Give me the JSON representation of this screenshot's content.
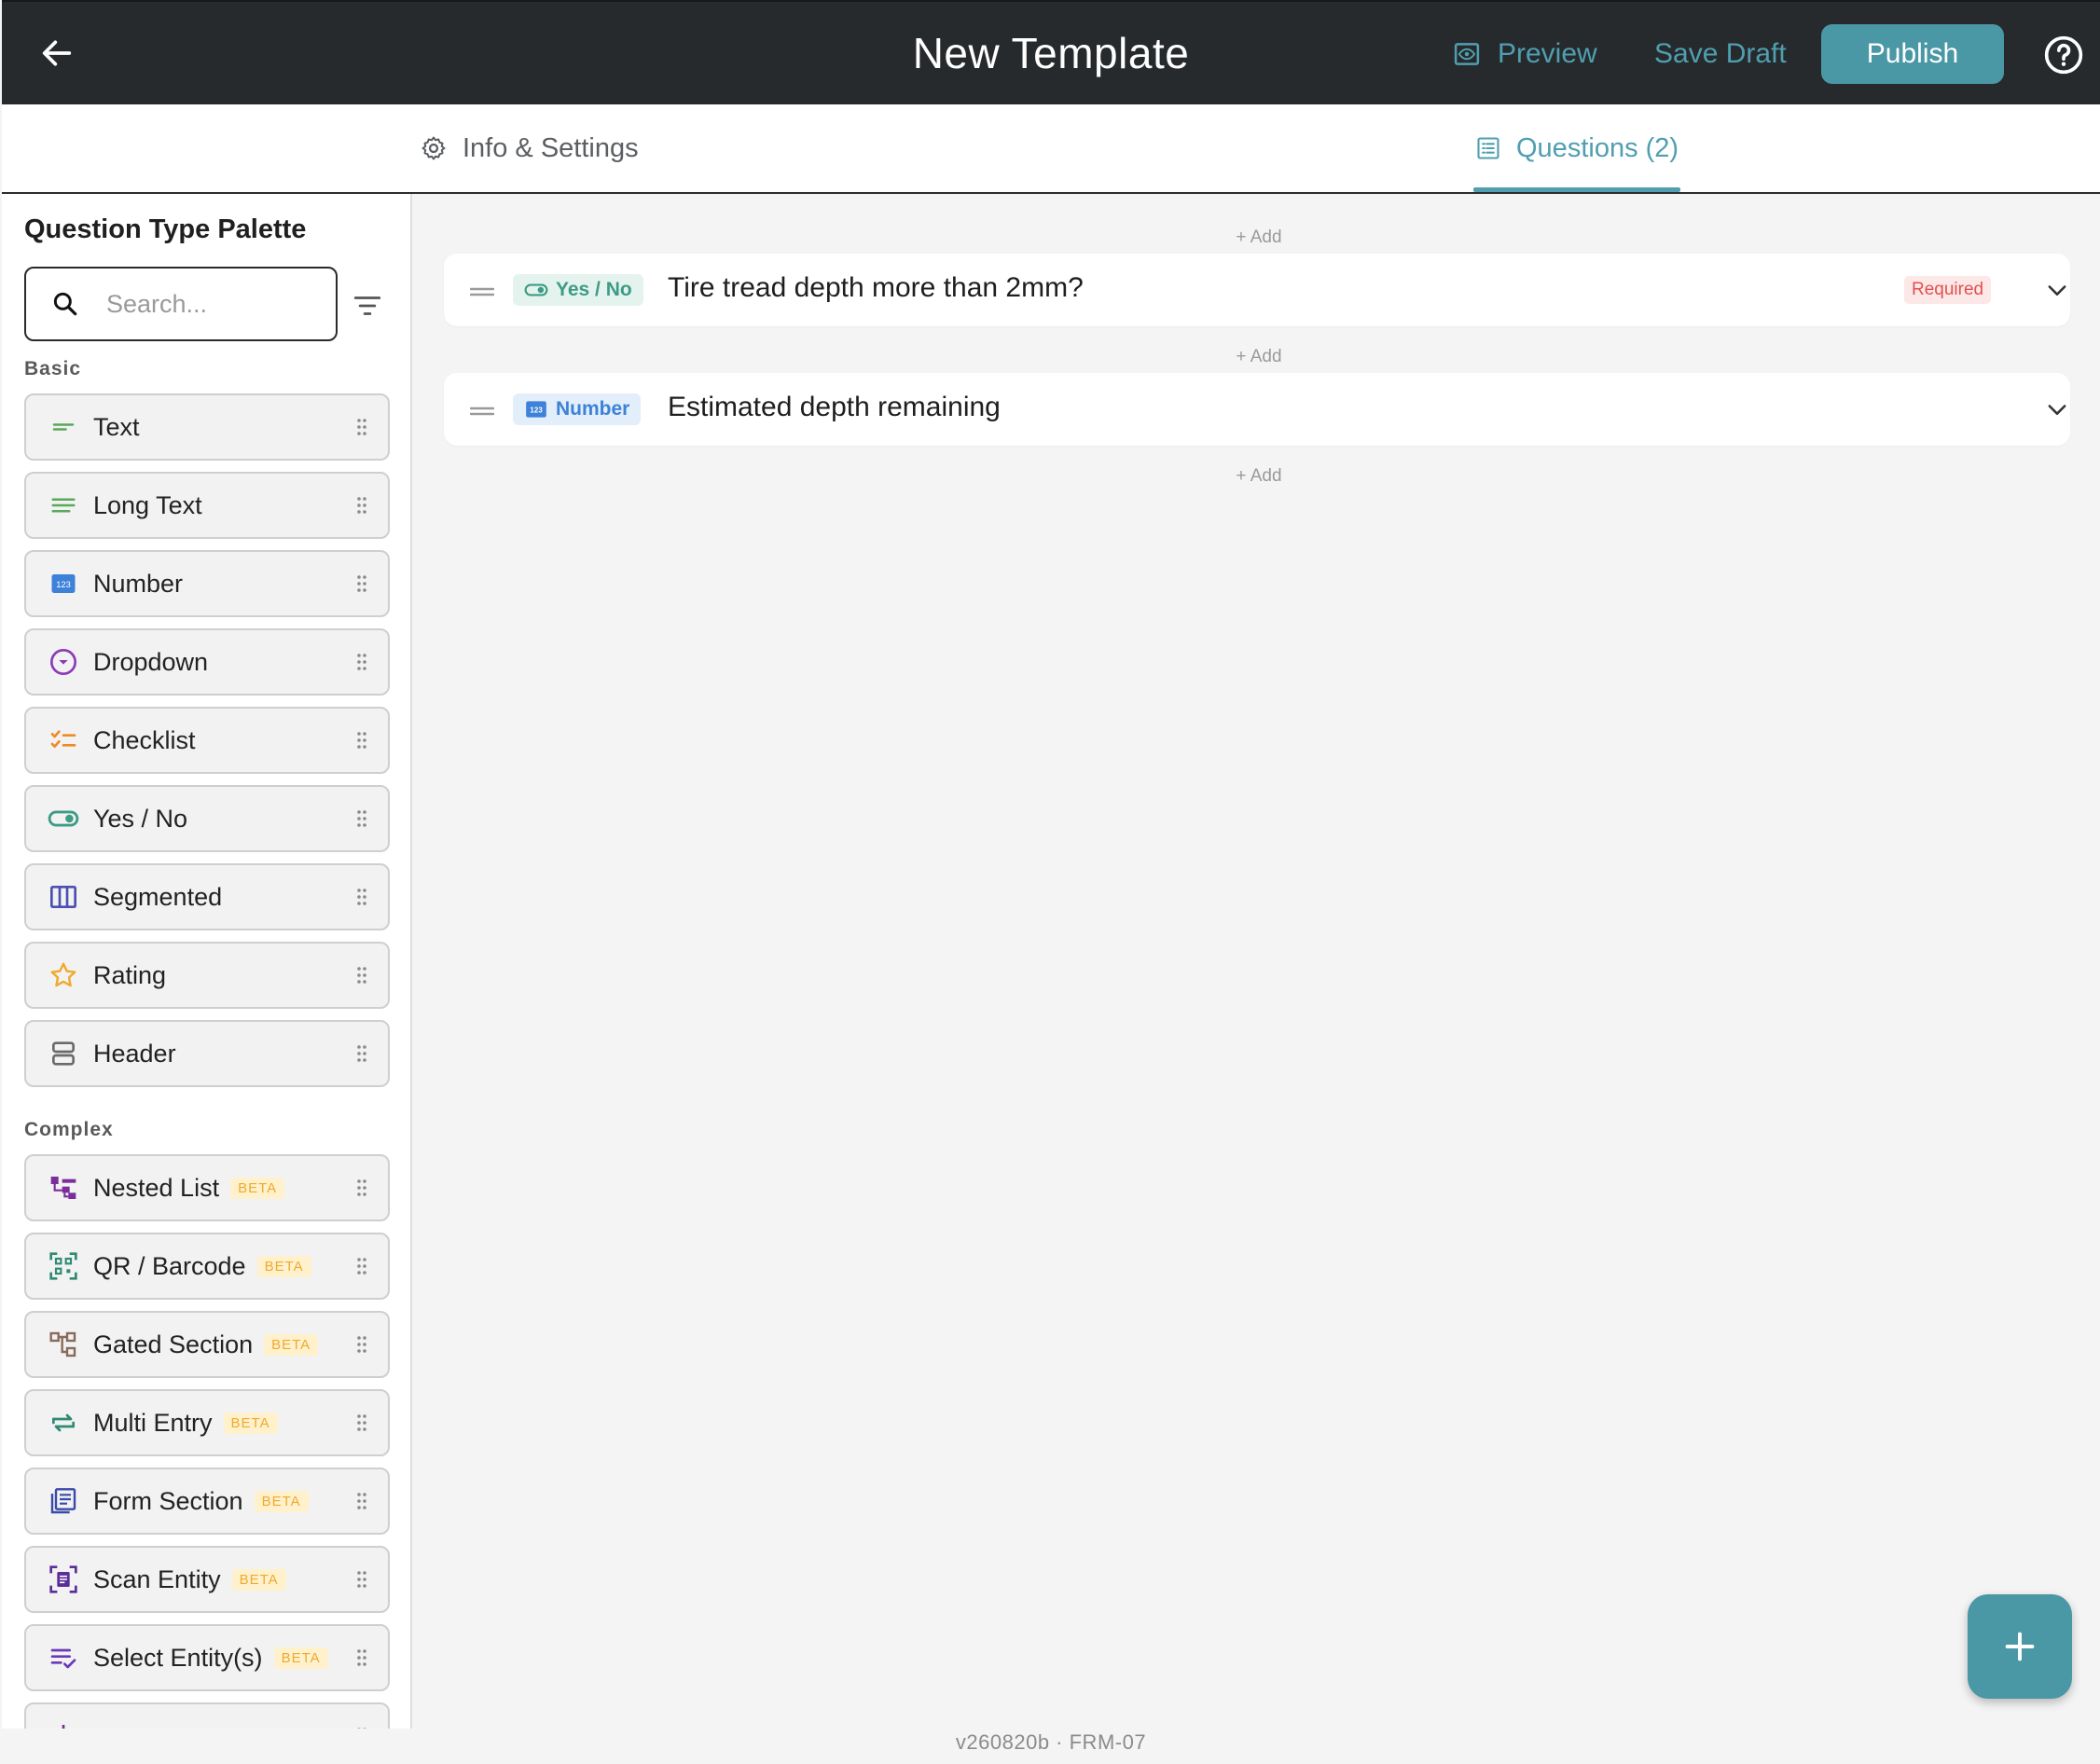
{
  "header": {
    "title": "New Template",
    "preview_label": "Preview",
    "save_draft_label": "Save Draft",
    "publish_label": "Publish",
    "icons": {
      "back": "arrow-left-icon",
      "preview": "eye-icon",
      "help": "help-circle-icon"
    }
  },
  "tabs": [
    {
      "label": "Info & Settings",
      "icon": "gear-icon",
      "active": false
    },
    {
      "label": "Questions (2)",
      "icon": "list-icon",
      "active": true
    }
  ],
  "palette": {
    "title": "Question Type Palette",
    "search_placeholder": "Search...",
    "groups": [
      {
        "label": "Basic",
        "items": [
          {
            "label": "Text",
            "icon": "text-short-icon"
          },
          {
            "label": "Long Text",
            "icon": "text-long-icon"
          },
          {
            "label": "Number",
            "icon": "number-123-icon"
          },
          {
            "label": "Dropdown",
            "icon": "dropdown-circle-icon"
          },
          {
            "label": "Checklist",
            "icon": "checklist-icon"
          },
          {
            "label": "Yes / No",
            "icon": "toggle-icon"
          },
          {
            "label": "Segmented",
            "icon": "segmented-columns-icon"
          },
          {
            "label": "Rating",
            "icon": "star-icon"
          },
          {
            "label": "Header",
            "icon": "header-rows-icon"
          }
        ]
      },
      {
        "label": "Complex",
        "items": [
          {
            "label": "Nested List",
            "icon": "nested-list-icon",
            "badge": "BETA"
          },
          {
            "label": "QR / Barcode",
            "icon": "qr-scan-icon",
            "badge": "BETA"
          },
          {
            "label": "Gated Section",
            "icon": "gated-tree-icon",
            "badge": "BETA"
          },
          {
            "label": "Multi Entry",
            "icon": "repeat-arrows-icon",
            "badge": "BETA"
          },
          {
            "label": "Form Section",
            "icon": "form-section-icon",
            "badge": "BETA"
          },
          {
            "label": "Scan Entity",
            "icon": "scan-entity-icon",
            "badge": "BETA"
          },
          {
            "label": "Select Entity(s)",
            "icon": "select-entity-icon",
            "badge": "BETA"
          }
        ]
      }
    ]
  },
  "questions": {
    "add_label": "+ Add",
    "items": [
      {
        "type_label": "Yes / No",
        "type_icon": "toggle-icon",
        "text": "Tire tread depth more than 2mm?",
        "required_label": "Required"
      },
      {
        "type_label": "Number",
        "type_icon": "number-123-icon",
        "text": "Estimated depth remaining"
      }
    ]
  },
  "footer": {
    "version": "v260820b · FRM-07"
  },
  "colors": {
    "topbar": "#272a2d",
    "accent": "#4a97a5",
    "beta_text": "#f0a92d",
    "beta_bg": "#fff1cc",
    "required_text": "#e0514f"
  }
}
